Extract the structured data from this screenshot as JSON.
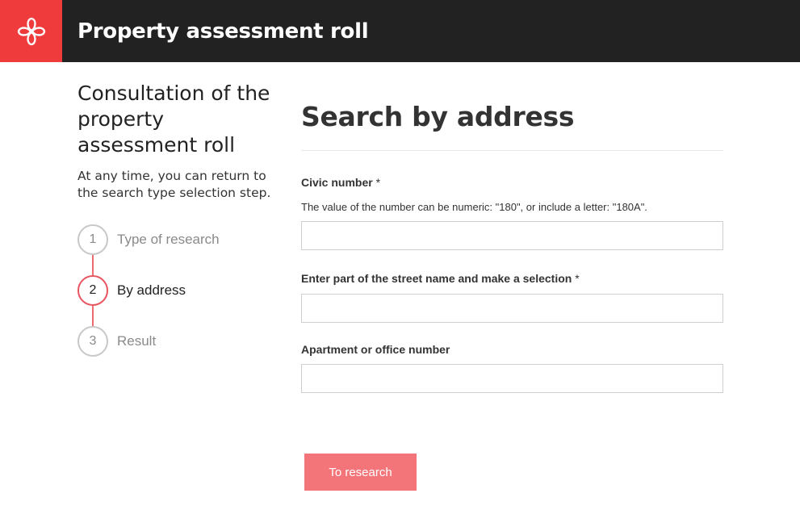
{
  "header": {
    "title": "Property assessment roll",
    "logo_icon": "montreal-rosette-icon",
    "bar_color": "#222222",
    "logo_color": "#ef3b3b"
  },
  "sidebar": {
    "title": "Consultation of the property assessment roll",
    "help": "At any time, you can return to the search type selection step.",
    "steps": [
      {
        "number": "1",
        "label": "Type of research",
        "state": "completed"
      },
      {
        "number": "2",
        "label": "By address",
        "state": "active"
      },
      {
        "number": "3",
        "label": "Result",
        "state": "upcoming"
      }
    ],
    "accent_color": "#e8545f"
  },
  "main": {
    "title": "Search by address",
    "fields": {
      "civic": {
        "label": "Civic number",
        "required_mark": "*",
        "help": "The value of the number can be numeric: \"180\", or include a letter: \"180A\".",
        "value": "",
        "placeholder": ""
      },
      "street": {
        "label": "Enter part of the street name and make a selection",
        "required_mark": "*",
        "value": "",
        "placeholder": ""
      },
      "apartment": {
        "label": "Apartment or office number",
        "value": "",
        "placeholder": ""
      }
    },
    "submit_label": "To research",
    "submit_color": "#f47579"
  }
}
